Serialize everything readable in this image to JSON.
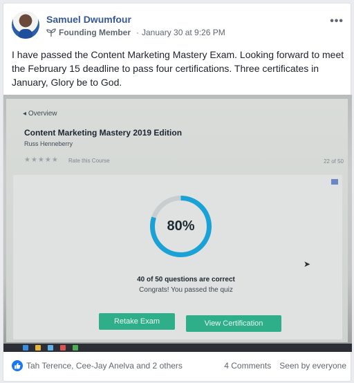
{
  "post": {
    "author": "Samuel Dwumfour",
    "badge": "Founding Member",
    "separator": "·",
    "timestamp": "January 30 at 9:26 PM",
    "more": "•••",
    "text": "I have passed the Content Marketing Mastery Exam. Looking forward to meet the February 15 deadline to pass four certifications. Three certificates in January, Glory be to God."
  },
  "photo": {
    "overview": "Overview",
    "course_title": "Content Marketing Mastery 2019 Edition",
    "course_author": "Russ Henneberry",
    "stars": "★★★★★",
    "rate_label": "Rate this Course",
    "progress_count": "22 of 50",
    "score_label": "80%",
    "score_value": 0.8,
    "correct_text": "40 of 50 questions are correct",
    "congrats_text": "Congrats! You passed the quiz",
    "retake_label": "Retake Exam",
    "view_cert_label": "View Certification",
    "ring_color": "#1aa1d6"
  },
  "footer": {
    "reactors": "Tah Terence, Cee-Jay Anelva and 2 others",
    "comments": "4 Comments",
    "seen": "Seen by everyone"
  },
  "colors": {
    "link": "#365899",
    "like": "#1877f2"
  }
}
